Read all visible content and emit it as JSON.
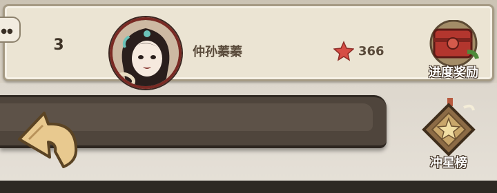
{
  "leaderboard_row": {
    "rank": "3",
    "player_name": "仲孙蓁蓁",
    "star_count": "366",
    "star_icon": "star-icon",
    "avatar_icon": "character-portrait"
  },
  "buttons": {
    "progress_reward": "进度奖励",
    "star_ranking": "冲星榜",
    "back_icon": "back-arrow-icon",
    "chat_icon": "chat-bubble-icon"
  },
  "colors": {
    "panel_bg": "#ebe4d3",
    "panel_border": "#a59a84",
    "text_dark": "#5a4b3b",
    "star_red": "#d64d45",
    "shelf_dark": "#4f453c"
  }
}
